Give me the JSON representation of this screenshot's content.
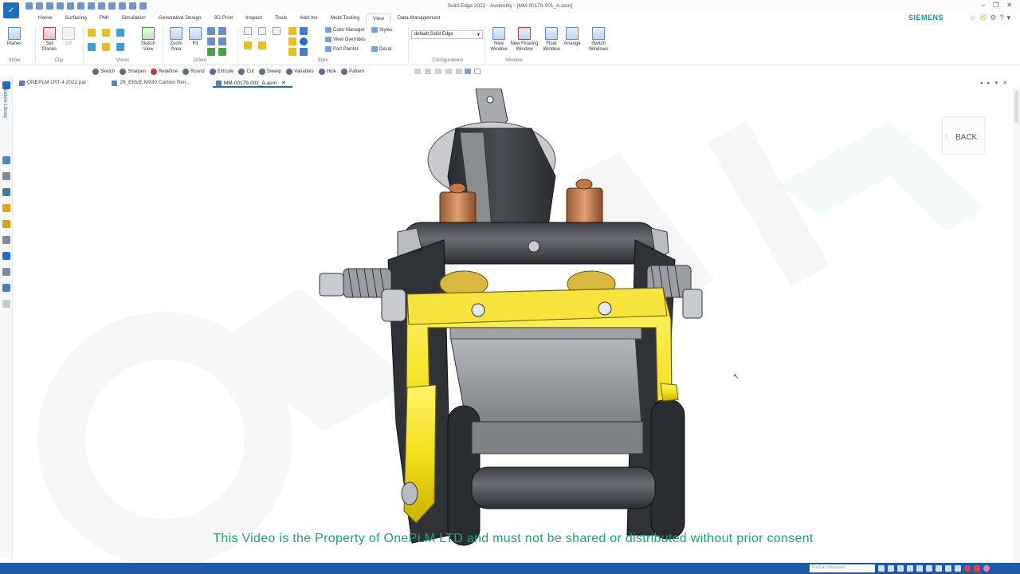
{
  "window": {
    "title": "Solid Edge 2022 - Assembly - [MM-00179-001_A.asm]"
  },
  "brand": "SIEMENS",
  "menu_tabs": [
    "Home",
    "Surfacing",
    "PMI",
    "Simulation",
    "Generative Design",
    "3D Print",
    "Inspect",
    "Tools",
    "Add-Ins",
    "Mold Tooling",
    "View",
    "Data Management"
  ],
  "active_tab": "View",
  "ribbon": {
    "show": {
      "planes": "Planes",
      "label": "Show"
    },
    "clip": {
      "set_planes": "Set Planes",
      "off": "Off",
      "label": "Clip"
    },
    "views": {
      "sketch_view": "Sketch View",
      "label": "Views"
    },
    "orient": {
      "zoom_area": "Zoom Area",
      "fit": "Fit",
      "label": "Orient"
    },
    "style": {
      "color_manager": "Color Manager",
      "view_overrides": "View Overrides",
      "part_painter": "Part Painter",
      "styles": "Styles",
      "decal": "Decal",
      "label": "Style"
    },
    "configurations": {
      "dropdown_value": "default,Solid Edge",
      "label": "Configurations"
    },
    "window": {
      "new_window": "New Window",
      "new_floating_window": "New Floating Window",
      "float_window": "Float Window",
      "arrange": "Arrange",
      "switch_windows": "Switch Windows",
      "label": "Window"
    }
  },
  "command_bar": [
    "Sketch",
    "Sharpen",
    "Redefine",
    "Round",
    "Extrude",
    "Cut",
    "Sweep",
    "Variables",
    "Hole",
    "Pattern"
  ],
  "doc_tabs": [
    {
      "label": "ONEPLM LRT-4 2022.par",
      "active": false
    },
    {
      "label": "29_ENVE M930 Carbon Rim...",
      "active": false
    },
    {
      "label": "MM-00179-001_A.asm",
      "active": true
    }
  ],
  "side_panel": {
    "feature_library": "Feature Library"
  },
  "canvas": {
    "back_button": "BACK",
    "watermark": "ONEPLM",
    "copyright_notice": "This Video is the Property of OnePLM LTD and must not be shared or distributed without prior consent"
  },
  "status_bar": {
    "find_placeholder": "Find a command"
  },
  "colors": {
    "accent": "#1b6ec2",
    "status_bar": "#1e5aa8",
    "brand": "#1b8fa8",
    "notice": "#17a57a",
    "part_yellow": "#f2df1a"
  }
}
